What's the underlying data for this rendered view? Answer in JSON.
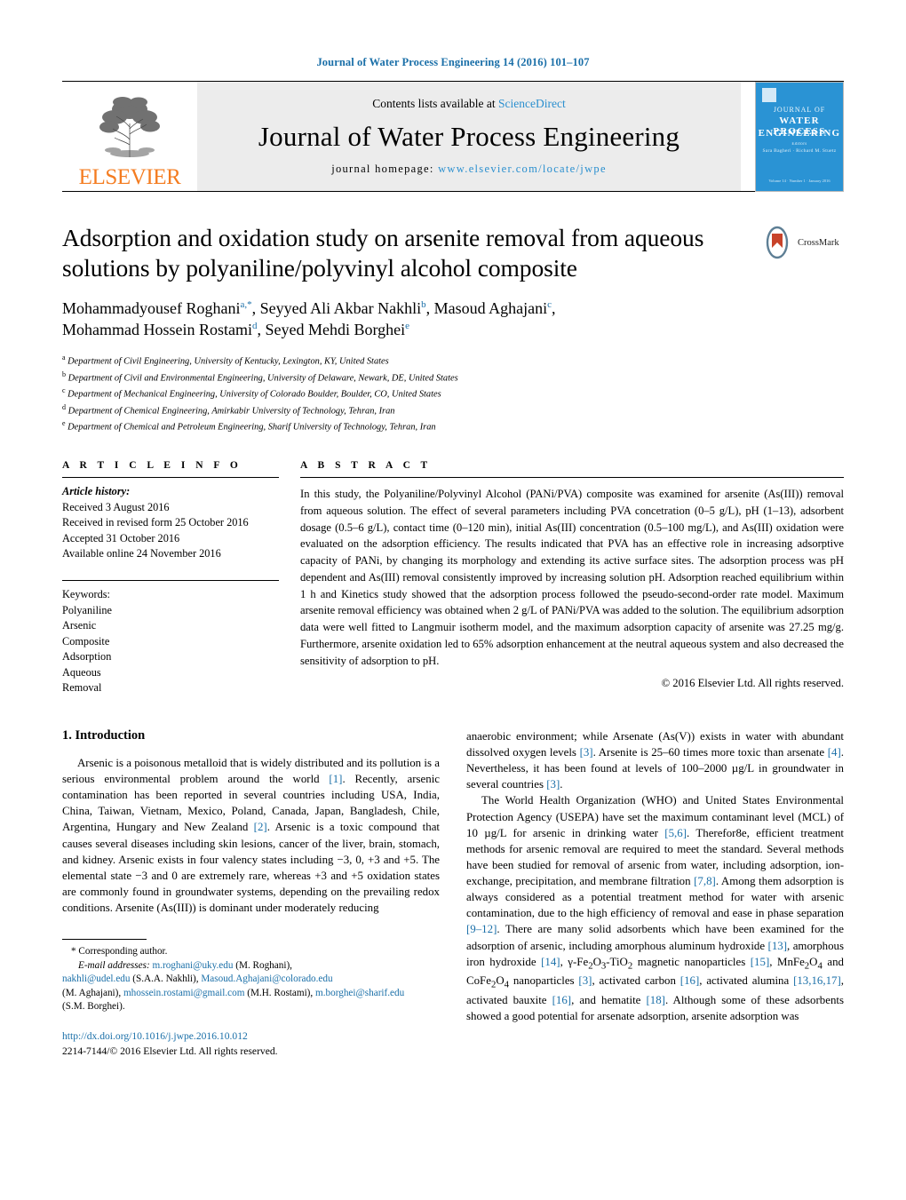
{
  "running_head": "Journal of Water Process Engineering 14 (2016) 101–107",
  "masthead": {
    "publisher": "ELSEVIER",
    "contents_prefix": "Contents lists available at ",
    "contents_link": "ScienceDirect",
    "journal_title": "Journal of Water Process Engineering",
    "homepage_prefix": "journal homepage: ",
    "homepage_url": "www.elsevier.com/locate/jwpe",
    "cover": {
      "line1": "JOURNAL OF",
      "line2": "WATER PROCESS",
      "line3": "ENGINEERING",
      "line4": "Editors",
      "line5": "Sara Bagheri · Richard M. Stuetz",
      "footer": "Volume 14 · Number 1 · January 2016"
    }
  },
  "crossmark": {
    "label": "CrossMark"
  },
  "article": {
    "title": "Adsorption and oxidation study on arsenite removal from aqueous solutions by polyaniline/polyvinyl alcohol composite",
    "authors": [
      {
        "name": "Mohammadyousef Roghani",
        "marks": "a,*"
      },
      {
        "name": "Seyyed Ali Akbar Nakhli",
        "marks": "b"
      },
      {
        "name": "Masoud Aghajani",
        "marks": "c"
      },
      {
        "name": "Mohammad Hossein Rostami",
        "marks": "d"
      },
      {
        "name": "Seyed Mehdi Borghei",
        "marks": "e"
      }
    ],
    "affiliations": [
      {
        "mark": "a",
        "text": "Department of Civil Engineering, University of Kentucky, Lexington, KY, United States"
      },
      {
        "mark": "b",
        "text": "Department of Civil and Environmental Engineering, University of Delaware, Newark, DE, United States"
      },
      {
        "mark": "c",
        "text": "Department of Mechanical Engineering, University of Colorado Boulder, Boulder, CO, United States"
      },
      {
        "mark": "d",
        "text": "Department of Chemical Engineering, Amirkabir University of Technology, Tehran, Iran"
      },
      {
        "mark": "e",
        "text": "Department of Chemical and Petroleum Engineering, Sharif University of Technology, Tehran, Iran"
      }
    ]
  },
  "article_info": {
    "heading": "A R T I C L E   I N F O",
    "history_label": "Article history:",
    "history": [
      "Received 3 August 2016",
      "Received in revised form 25 October 2016",
      "Accepted 31 October 2016",
      "Available online 24 November 2016"
    ],
    "keywords_label": "Keywords:",
    "keywords": [
      "Polyaniline",
      "Arsenic",
      "Composite",
      "Adsorption",
      "Aqueous",
      "Removal"
    ]
  },
  "abstract": {
    "heading": "A B S T R A C T",
    "text": "In this study, the Polyaniline/Polyvinyl Alcohol (PANi/PVA) composite was examined for arsenite (As(III)) removal from aqueous solution. The effect of several parameters including PVA concetration (0–5 g/L), pH (1–13), adsorbent dosage (0.5–6 g/L), contact time (0–120 min), initial As(III) concentration (0.5–100 mg/L), and As(III) oxidation were evaluated on the adsorption efficiency. The results indicated that PVA has an effective role in increasing adsorptive capacity of PANi, by changing its morphology and extending its active surface sites. The adsorption process was pH dependent and As(III) removal consistently improved by increasing solution pH. Adsorption reached equilibrium within 1 h and Kinetics study showed that the adsorption process followed the pseudo-second-order rate model. Maximum arsenite removal efficiency was obtained when 2 g/L of PANi/PVA was added to the solution. The equilibrium adsorption data were well fitted to Langmuir isotherm model, and the maximum adsorption capacity of arsenite was 27.25 mg/g. Furthermore, arsenite oxidation led to 65% adsorption enhancement at the neutral aqueous system and also decreased the sensitivity of adsorption to pH.",
    "copyright": "© 2016 Elsevier Ltd. All rights reserved."
  },
  "body": {
    "section_heading": "1.  Introduction",
    "left_paragraph_1": "Arsenic is a poisonous metalloid that is widely distributed and its pollution is a serious environmental problem around the world [1]. Recently, arsenic contamination has been reported in several countries including USA, India, China, Taiwan, Vietnam, Mexico, Poland, Canada, Japan, Bangladesh, Chile, Argentina, Hungary and New Zealand [2]. Arsenic is a toxic compound that causes several diseases including skin lesions, cancer of the liver, brain, stomach, and kidney. Arsenic exists in four valency states including −3, 0, +3 and +5. The elemental state −3 and 0 are extremely rare, whereas +3 and +5 oxidation states are commonly found in groundwater systems, depending on the prevailing redox conditions. Arsenite (As(III)) is dominant under moderately reducing",
    "right_paragraph_1": "anaerobic environment; while Arsenate (As(V)) exists in water with abundant dissolved oxygen levels [3]. Arsenite is 25–60 times more toxic than arsenate [4]. Nevertheless, it has been found at levels of 100–2000 µg/L in groundwater in several countries [3].",
    "right_paragraph_2": "The World Health Organization (WHO) and United States Environmental Protection Agency (USEPA) have set the maximum contaminant level (MCL) of 10 µg/L for arsenic in drinking water [5,6]. Therefor8e, efficient treatment methods for arsenic removal are required to meet the standard. Several methods have been studied for removal of arsenic from water, including adsorption, ion-exchange, precipitation, and membrane filtration [7,8]. Among them adsorption is always considered as a potential treatment method for water with arsenic contamination, due to the high efficiency of removal and ease in phase separation [9–12]. There are many solid adsorbents which have been examined for the adsorption of arsenic, including amorphous aluminum hydroxide [13], amorphous iron hydroxide [14], γ-Fe2O3-TiO2 magnetic nanoparticles [15], MnFe2O4 and CoFe2O4 nanoparticles [3], activated carbon [16], activated alumina [13,16,17], activated bauxite [16], and hematite [18]. Although some of these adsorbents showed a good potential for arsenate adsorption, arsenite adsorption was"
  },
  "footnote": {
    "corresponding": "* Corresponding author.",
    "email_label": "E-mail addresses:",
    "emails": [
      {
        "address": "m.roghani@uky.edu",
        "owner": "(M. Roghani),"
      },
      {
        "address": "nakhli@udel.edu",
        "owner": "(S.A.A. Nakhli),"
      },
      {
        "address": "Masoud.Aghajani@colorado.edu",
        "owner": "(M. Aghajani),"
      },
      {
        "address": "mhossein.rostami@gmail.com",
        "owner": "(M.H. Rostami),"
      },
      {
        "address": "m.borghei@sharif.edu",
        "owner": "(S.M. Borghei)."
      }
    ]
  },
  "doi_block": {
    "doi_url": "http://dx.doi.org/10.1016/j.jwpe.2016.10.012",
    "issn_line": "2214-7144/© 2016 Elsevier Ltd. All rights reserved."
  },
  "colors": {
    "link_blue": "#1a6fa8",
    "sciencedirect_blue": "#2a8fcf",
    "elsevier_orange": "#f47c20",
    "cover_blue": "#2a93d4"
  }
}
